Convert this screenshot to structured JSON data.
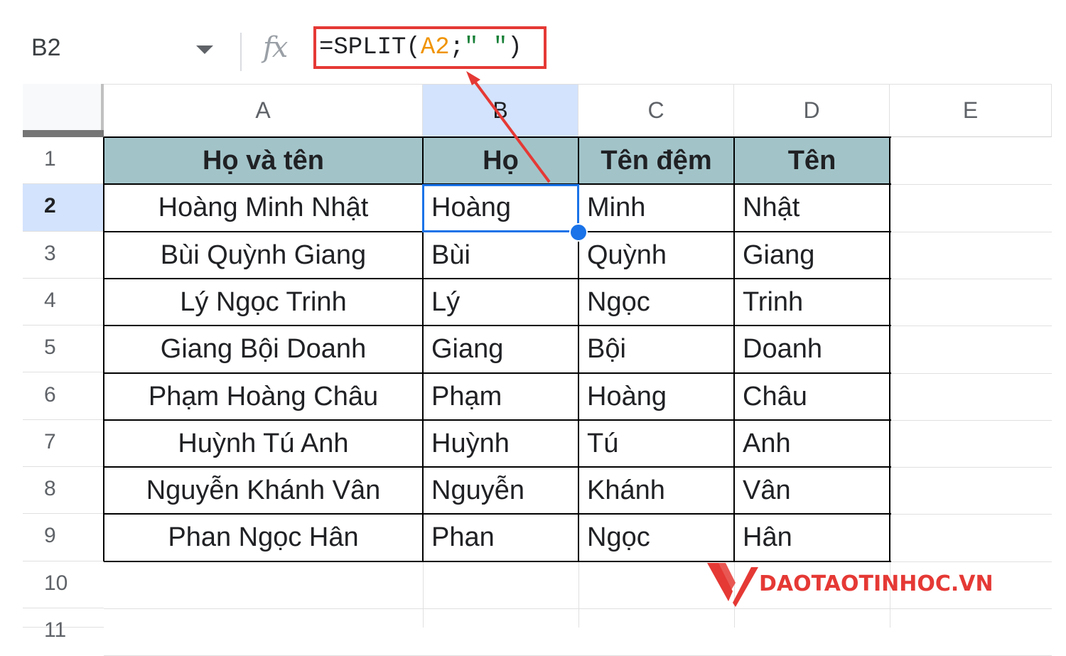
{
  "name_box": {
    "value": "B2"
  },
  "formula_bar": {
    "fx_label": "fx",
    "parts": [
      {
        "text": "=SPLIT(",
        "kind": "func"
      },
      {
        "text": "A2",
        "kind": "ref"
      },
      {
        "text": ";",
        "kind": "func"
      },
      {
        "text": "\" \"",
        "kind": "str"
      },
      {
        "text": ")",
        "kind": "func"
      }
    ],
    "highlight_color": "#e53935"
  },
  "columns": [
    "A",
    "B",
    "C",
    "D",
    "E"
  ],
  "selected_column": "B",
  "rows": [
    "1",
    "2",
    "3",
    "4",
    "5",
    "6",
    "7",
    "8",
    "9",
    "10",
    "11"
  ],
  "selected_row": "2",
  "selected_cell": "B2",
  "table": {
    "header_color": "#a2c4c9",
    "headers": [
      "Họ và tên",
      "Họ",
      "Tên đệm",
      "Tên"
    ],
    "data": [
      [
        "Hoàng Minh Nhật",
        "Hoàng",
        "Minh",
        "Nhật"
      ],
      [
        "Bùi Quỳnh Giang",
        "Bùi",
        "Quỳnh",
        "Giang"
      ],
      [
        "Lý Ngọc Trinh",
        "Lý",
        "Ngọc",
        "Trinh"
      ],
      [
        "Giang Bội Doanh",
        "Giang",
        "Bội",
        "Doanh"
      ],
      [
        "Phạm Hoàng Châu",
        "Phạm",
        "Hoàng",
        "Châu"
      ],
      [
        "Huỳnh Tú Anh",
        "Huỳnh",
        "Tú",
        "Anh"
      ],
      [
        "Nguyễn Khánh Vân",
        "Nguyễn",
        "Khánh",
        "Vân"
      ],
      [
        "Phan Ngọc Hân",
        "Phan",
        "Ngọc",
        "Hân"
      ]
    ]
  },
  "watermark": {
    "text": "DAOTAOTINHOC.VN",
    "color": "#e53935"
  },
  "accent_color": "#1a73e8"
}
